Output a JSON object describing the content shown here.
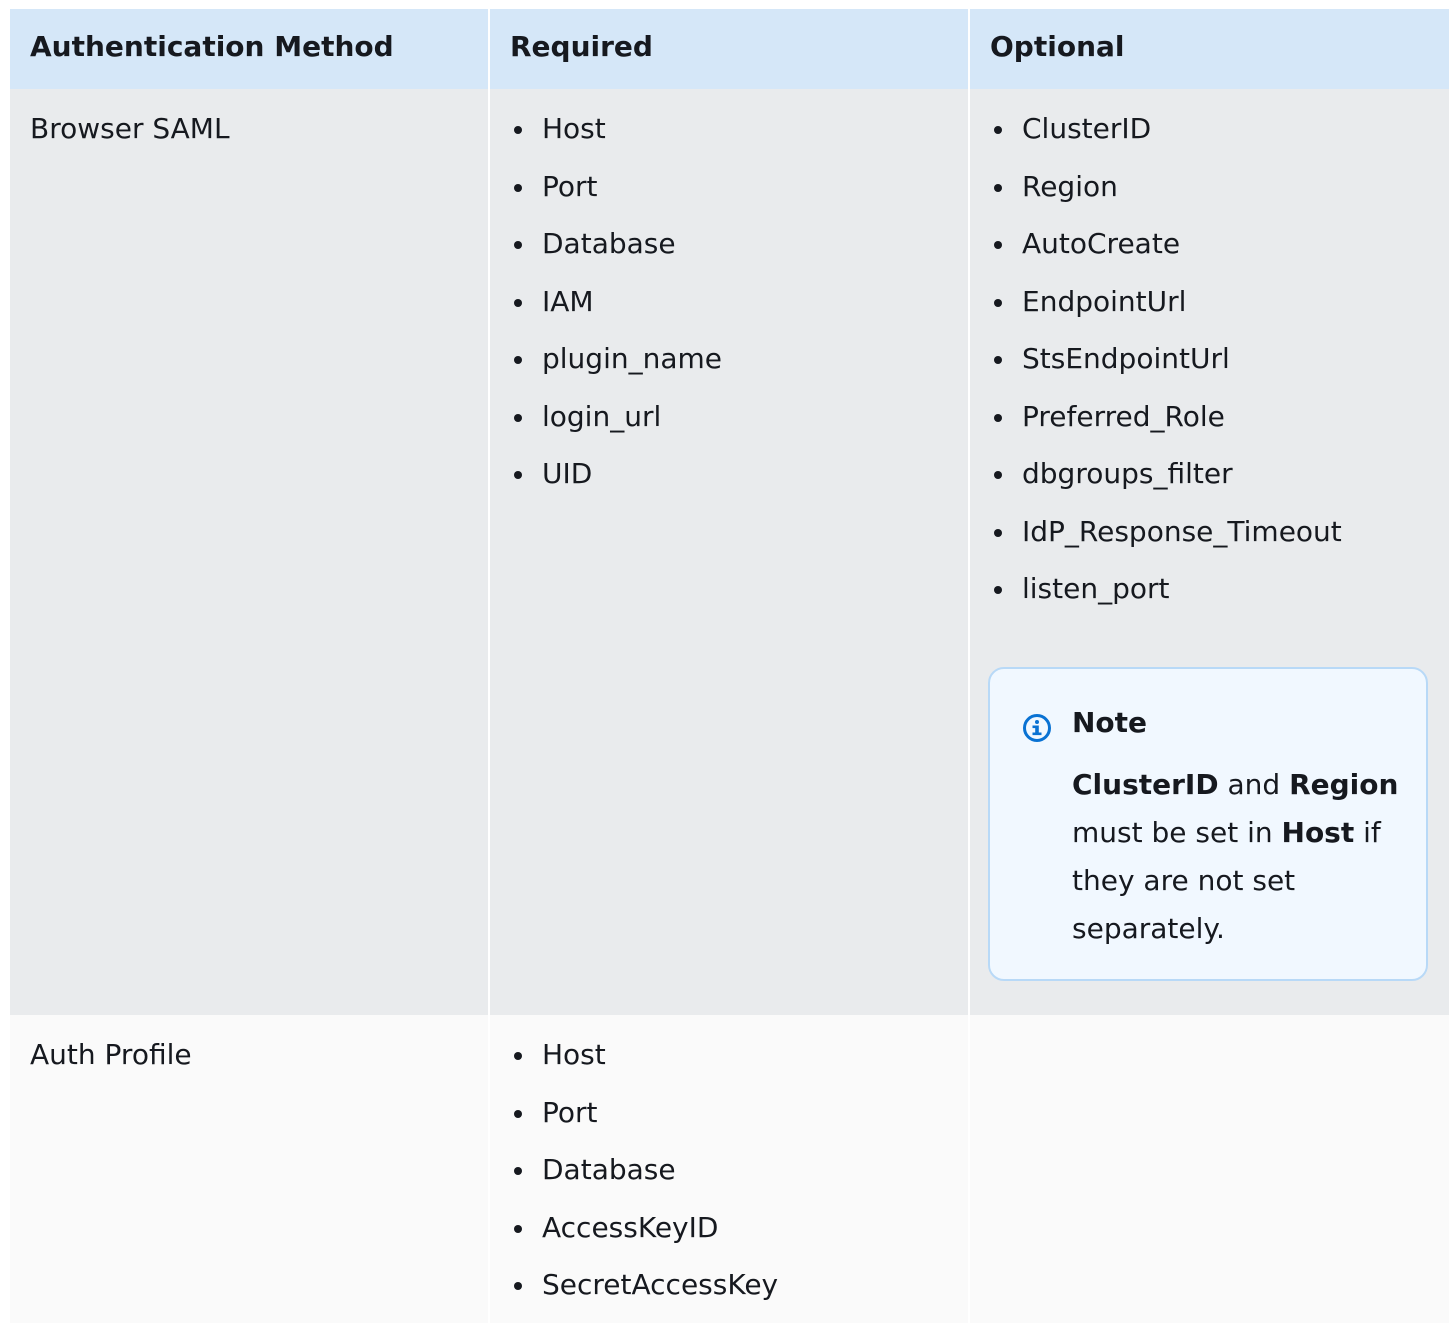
{
  "header": {
    "col1": "Authentication Method",
    "col2": "Required",
    "col3": "Optional"
  },
  "rows": [
    {
      "method": "Browser SAML",
      "required": [
        "Host",
        "Port",
        "Database",
        "IAM",
        "plugin_name",
        "login_url",
        "UID"
      ],
      "optional": [
        "ClusterID",
        "Region",
        "AutoCreate",
        "EndpointUrl",
        "StsEndpointUrl",
        "Preferred_Role",
        "dbgroups_filter",
        "IdP_Response_Timeout",
        "listen_port"
      ],
      "note": {
        "title": "Note",
        "icon": "info-icon",
        "term1": "ClusterID",
        "text1": " and ",
        "term2": "Region",
        "text2": " must be set in ",
        "term3": "Host",
        "text3": " if they are not set separately."
      }
    },
    {
      "method": "Auth Profile",
      "required": [
        "Host",
        "Port",
        "Database",
        "AccessKeyID",
        "SecretAccessKey"
      ],
      "optional": []
    }
  ],
  "colors": {
    "header_bg": "#d5e7f8",
    "row_a_bg": "#e9ebed",
    "row_b_bg": "#fafafa",
    "note_bg": "#f1f8ff",
    "note_border": "#b8d9f7",
    "info_blue": "#0972d3"
  }
}
